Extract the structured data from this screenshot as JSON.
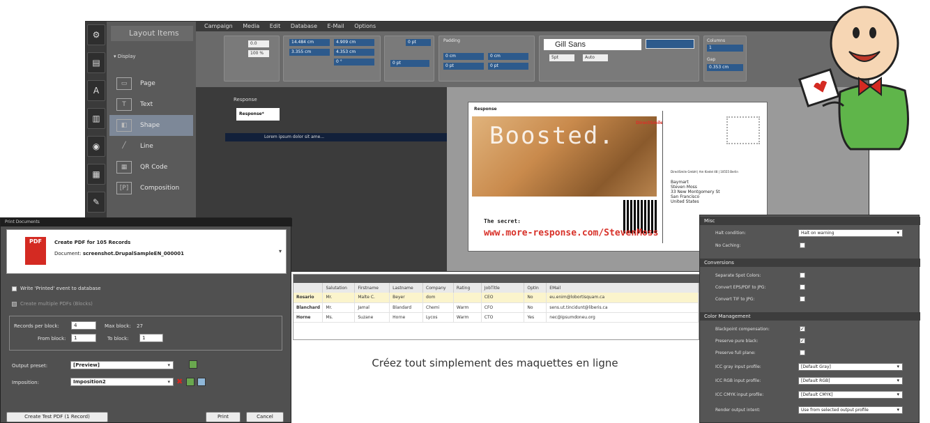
{
  "app": {
    "menu": [
      "Campaign",
      "Media",
      "Edit",
      "Database",
      "E-Mail",
      "Options"
    ],
    "layout_panel_title": "Layout Items",
    "tree_root": "Display",
    "items": [
      {
        "label": "Page",
        "icon": "page-icon"
      },
      {
        "label": "Text",
        "icon": "text-icon"
      },
      {
        "label": "Shape",
        "icon": "shape-icon"
      },
      {
        "label": "Line",
        "icon": "line-icon"
      },
      {
        "label": "QR Code",
        "icon": "qr-code-icon"
      },
      {
        "label": "Composition",
        "icon": "composition-icon"
      }
    ],
    "toolbar": {
      "zoom": "0.0",
      "zoom_pct": "100 %",
      "x": "14.484 cm",
      "y": "3.355 cm",
      "w": "4.909 cm",
      "h": "4.353 cm",
      "rotation": "0 °",
      "stroke": "0 pt",
      "pos": "0 pt",
      "padding_label": "Padding",
      "pad_left": "0 cm",
      "pad_top": "0 pt",
      "pad_right": "0 cm",
      "pad_bottom": "0 pt",
      "font_family": "Gill Sans",
      "font_size": "5pt",
      "leading": "Auto",
      "columns_label": "Columns",
      "columns": "1",
      "gap_label": "Gap",
      "gap": "0.353 cm"
    },
    "tree": {
      "response_label": "Response",
      "response_text": "Response*",
      "lorem": "Lorem ipsum dolor sit ame..."
    },
    "card": {
      "heading": "Response",
      "boost": "Boosted.",
      "brand": "DirectSmile",
      "address_lines": [
        "DirectSmile GmbH | Am Kiedel 48 | 10555 Berlin",
        "Baymart",
        "Steven Moss",
        "33 New Montgomery St",
        "San Francisco",
        "United States"
      ],
      "secret": "The secret:",
      "url": "www.more-response.com/StevenMoss"
    }
  },
  "table": {
    "columns": [
      "",
      "Salutation",
      "Firstname",
      "Lastname",
      "Company",
      "Rating",
      "JobTitle",
      "OptIn",
      "EMail"
    ],
    "rows": [
      [
        "Rosario",
        "Mr.",
        "Malte C.",
        "Beyer",
        "dom",
        "",
        "CEO",
        "No",
        "eu.enim@lobortisquam.ca"
      ],
      [
        "Blanchard",
        "Mr.",
        "Jamal",
        "Blandard",
        "Chemi",
        "Warm",
        "CFO",
        "No",
        "sens.ut.tincidunt@liberis.ca"
      ],
      [
        "Horne",
        "Ms.",
        "Suzane",
        "Horne",
        "Lycos",
        "Warm",
        "CTO",
        "Yes",
        "nec@ipsumdoneu.org"
      ]
    ]
  },
  "caption": "Créez tout simplement des maquettes en ligne",
  "print_dialog": {
    "title": "Print Documents",
    "create_line": "Create PDF for 105 Records",
    "document_label": "Document:",
    "document_value": "screenshot.DrupalSampleEN_000001",
    "write_event": "Write 'Printed' event to database",
    "multiple_pdfs": "Create multiple PDFs (Blocks)",
    "records_per_block_label": "Records per block:",
    "records_per_block": "4",
    "max_block_label": "Max block:",
    "max_block": "27",
    "from_block_label": "From block:",
    "from_block": "1",
    "to_block_label": "To block:",
    "to_block": "1",
    "output_preset_label": "Output preset:",
    "output_preset": "[Preview]",
    "imposition_label": "Imposition:",
    "imposition": "Imposition2",
    "test_button": "Create Test PDF (1 Record)",
    "print_button": "Print",
    "cancel_button": "Cancel",
    "pdf_icon_text": "PDF"
  },
  "settings": {
    "misc": "Misc",
    "halt_label": "Halt condition:",
    "halt_value": "Halt on warning",
    "no_caching": "No Caching:",
    "conversions": "Conversions",
    "spot_colors": "Separate Spot Colors:",
    "eps_pdf": "Convert EPS/PDF to JPG:",
    "tif_jpg": "Convert TIF to JPG:",
    "color_mgmt": "Color Management",
    "bpc": "Blackpoint compensation:",
    "pure_black": "Preserve pure black:",
    "full_planes": "Preserve full plane:",
    "gray_label": "ICC gray input profile:",
    "gray_value": "[Default Gray]",
    "rgb_label": "ICC RGB input profile:",
    "rgb_value": "[Default RGB]",
    "cmyk_label": "ICC CMYK input profile:",
    "cmyk_value": "[Default CMYK]",
    "intent_label": "Render output intent:",
    "intent_value": "Use from selected output profile"
  },
  "colors": {
    "accent_blue": "#2d5a8c",
    "selected_item": "#7d8898",
    "pdf_red": "#d42a22",
    "url_red": "#d8322a"
  }
}
